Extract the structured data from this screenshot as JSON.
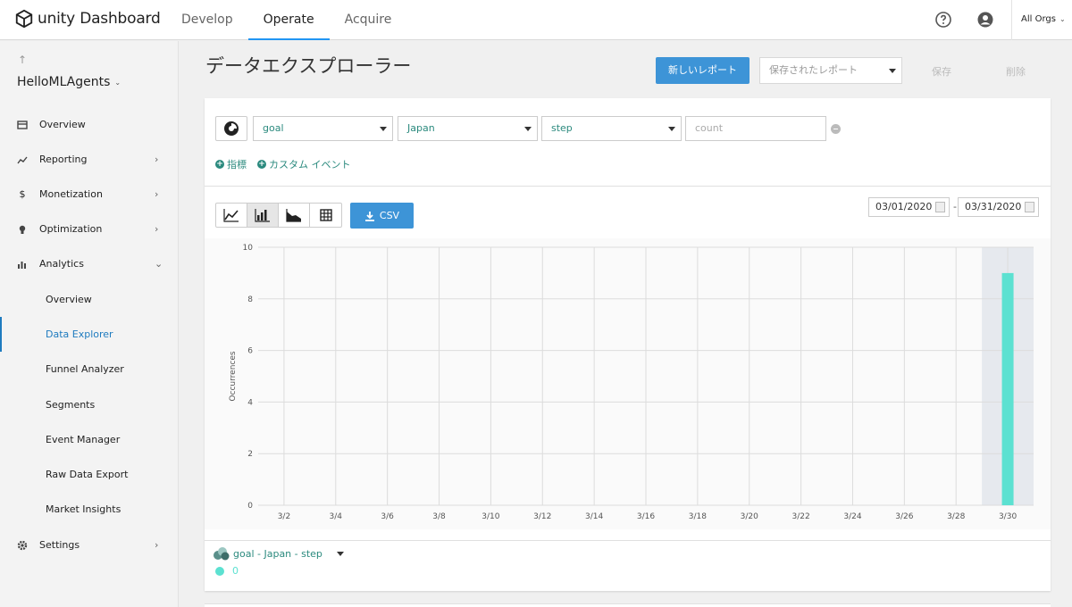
{
  "brand": {
    "logo_text": "unity Dashboard"
  },
  "topnav": {
    "items": [
      "Develop",
      "Operate",
      "Acquire"
    ],
    "active": "Operate"
  },
  "header": {
    "org_select": "All Orgs"
  },
  "sidebar": {
    "back_arrow": "↑",
    "project_name": "HelloMLAgents",
    "items": [
      {
        "label": "Overview",
        "icon": "overview-icon"
      },
      {
        "label": "Reporting",
        "icon": "reporting-icon"
      },
      {
        "label": "Monetization",
        "icon": "dollar-icon"
      },
      {
        "label": "Optimization",
        "icon": "bulb-icon"
      },
      {
        "label": "Analytics",
        "icon": "analytics-icon"
      }
    ],
    "analytics_sub": [
      "Overview",
      "Data Explorer",
      "Funnel Analyzer",
      "Segments",
      "Event Manager",
      "Raw Data Export",
      "Market Insights"
    ],
    "active_sub": "Data Explorer",
    "settings": {
      "label": "Settings",
      "icon": "gear-icon"
    }
  },
  "page": {
    "title": "データエクスプローラー",
    "new_report_label": "新しいレポート",
    "saved_reports_placeholder": "保存されたレポート",
    "save_label": "保存",
    "delete_label": "削除"
  },
  "filters": {
    "metric": "goal",
    "country": "Japan",
    "parameter": "step",
    "aggregation_placeholder": "count",
    "add_metric": "指標",
    "add_custom_event": "カスタム イベント"
  },
  "toolbar": {
    "csv_label": "CSV",
    "start_date": "03/01/2020",
    "date_separator": "-",
    "end_date": "03/31/2020",
    "chart_types": [
      "line-chart-icon",
      "bar-chart-icon",
      "area-chart-icon",
      "table-icon"
    ],
    "active_chart_type": "bar-chart-icon"
  },
  "legend": {
    "series_name": "goal - Japan - step",
    "value_label": "0"
  },
  "colors": {
    "accent": "#3d94d7",
    "bar": "#5ce1d1",
    "link": "#2b8a7e"
  },
  "chart_data": {
    "type": "bar",
    "ylabel": "Occurrences",
    "xlabel": "",
    "ylim": [
      0,
      10
    ],
    "ytick_labels": [
      "0",
      "2",
      "4",
      "6",
      "8",
      "10"
    ],
    "categories": [
      "3/1",
      "3/2",
      "3/3",
      "3/4",
      "3/5",
      "3/6",
      "3/7",
      "3/8",
      "3/9",
      "3/10",
      "3/11",
      "3/12",
      "3/13",
      "3/14",
      "3/15",
      "3/16",
      "3/17",
      "3/18",
      "3/19",
      "3/20",
      "3/21",
      "3/22",
      "3/23",
      "3/24",
      "3/25",
      "3/26",
      "3/27",
      "3/28",
      "3/29",
      "3/30",
      "3/31"
    ],
    "xtick_labels": [
      "3/2",
      "3/4",
      "3/6",
      "3/8",
      "3/10",
      "3/12",
      "3/14",
      "3/16",
      "3/18",
      "3/20",
      "3/22",
      "3/24",
      "3/26",
      "3/28",
      "3/30"
    ],
    "series": [
      {
        "name": "goal - Japan - step",
        "values": [
          0,
          0,
          0,
          0,
          0,
          0,
          0,
          0,
          0,
          0,
          0,
          0,
          0,
          0,
          0,
          0,
          0,
          0,
          0,
          0,
          0,
          0,
          0,
          0,
          0,
          0,
          0,
          0,
          0,
          9,
          0
        ]
      }
    ],
    "highlighted_category": "3/30",
    "grid": true
  }
}
